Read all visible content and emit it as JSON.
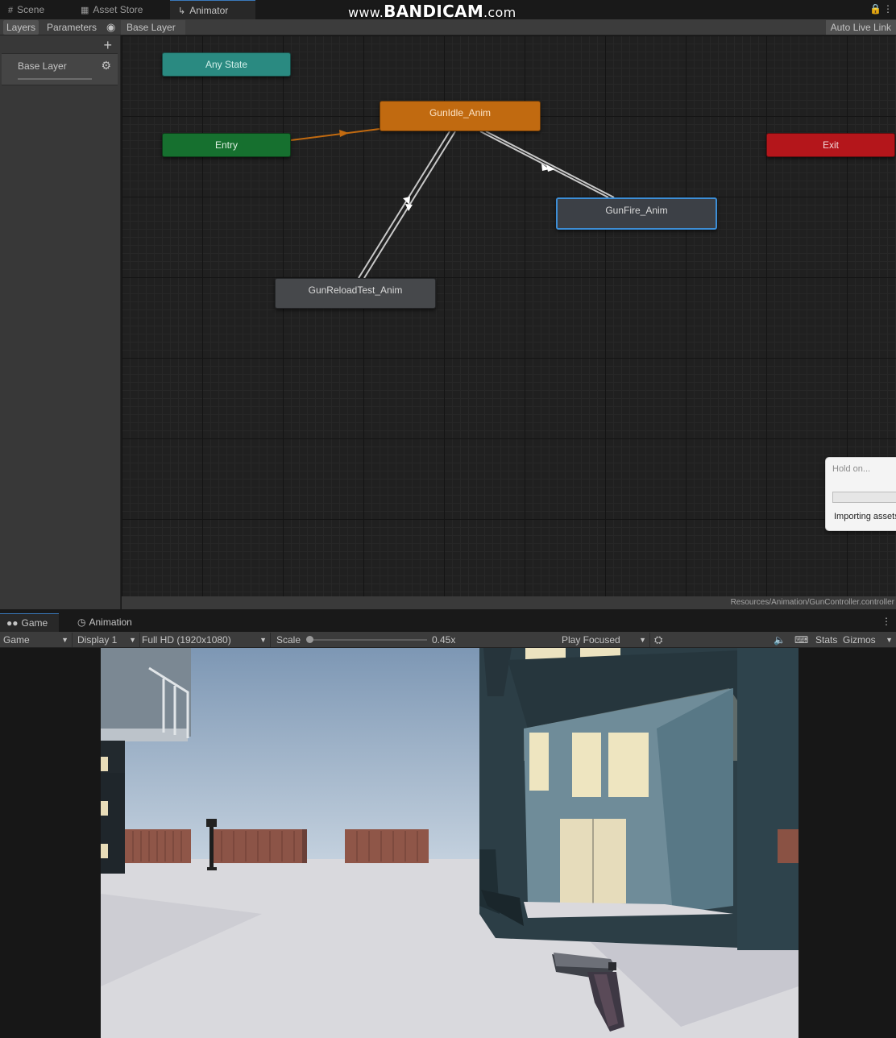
{
  "top_tabs": [
    {
      "label": "Scene",
      "icon": "grid-icon"
    },
    {
      "label": "Asset Store",
      "icon": "bag-icon"
    },
    {
      "label": "Animator",
      "icon": "animator-icon"
    }
  ],
  "watermark": {
    "prefix": "www.",
    "brand": "BANDICAM",
    "suffix": ".com"
  },
  "animator_toolbar": {
    "layers_label": "Layers",
    "parameters_label": "Parameters",
    "breadcrumb": "Base Layer",
    "auto_live_link": "Auto Live Link"
  },
  "sidebar": {
    "layers": [
      {
        "name": "Base Layer"
      }
    ]
  },
  "graph": {
    "states": {
      "any_state": "Any State",
      "entry": "Entry",
      "exit": "Exit",
      "idle": "GunIdle_Anim",
      "fire": "GunFire_Anim",
      "reload": "GunReloadTest_Anim"
    },
    "default_state": "GunIdle_Anim",
    "selected_state": "GunFire_Anim",
    "colors": {
      "any_state": "#2a8a81",
      "entry": "#16702f",
      "exit": "#b4161b",
      "default_state": "#c16a10",
      "selection": "#3d8ed6"
    },
    "asset_path": "Resources/Animation/GunController.controller"
  },
  "dialog": {
    "title": "Hold on...",
    "message": "Importing assets"
  },
  "bottom_tabs": [
    {
      "label": "Game",
      "icon": "gamepad-icon"
    },
    {
      "label": "Animation",
      "icon": "clock-icon"
    }
  ],
  "game_toolbar": {
    "mode": "Game",
    "display": "Display 1",
    "resolution": "Full HD (1920x1080)",
    "scale_label": "Scale",
    "scale_value": "0.45x",
    "play_mode": "Play Focused",
    "stats_label": "Stats",
    "gizmos_label": "Gizmos"
  }
}
